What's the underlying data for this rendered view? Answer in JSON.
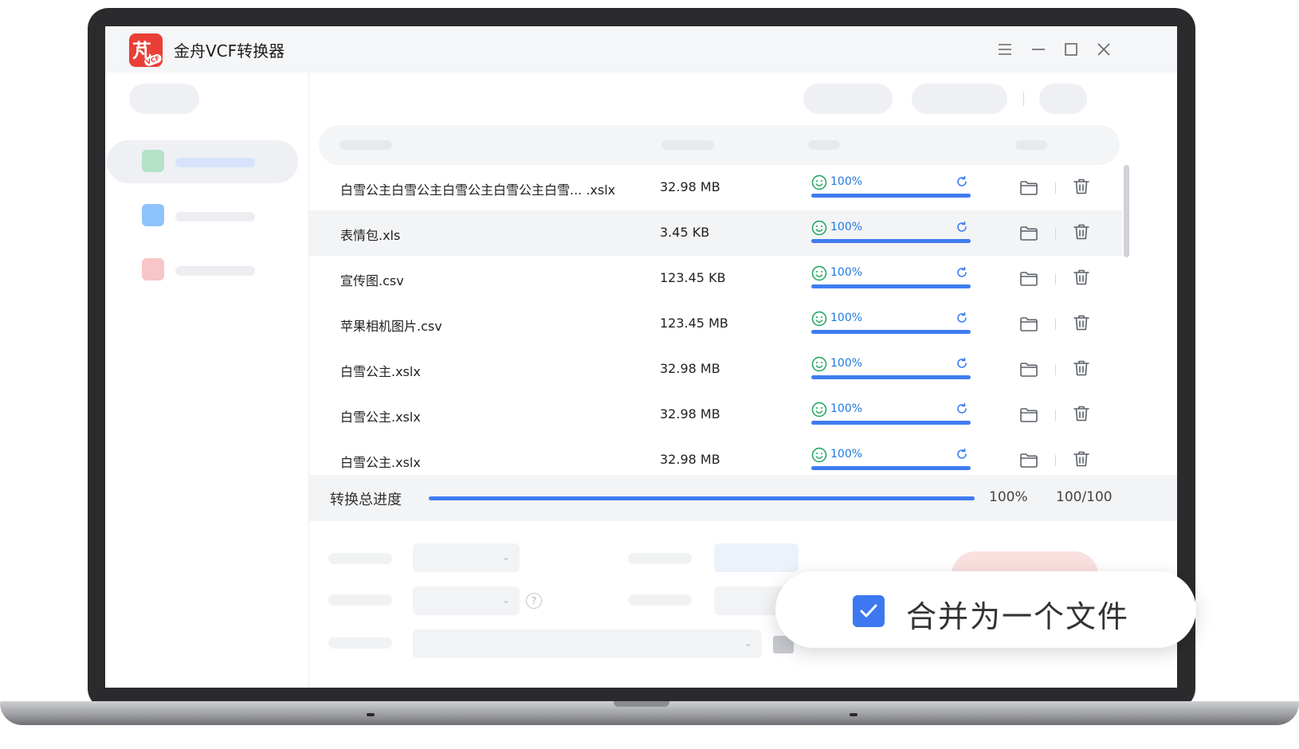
{
  "app": {
    "title": "金舟VCF转换器",
    "logo_glyph": "芃",
    "logo_tag": "VCF"
  },
  "window_controls": [
    "menu-icon",
    "minimize-icon",
    "maximize-icon",
    "close-icon"
  ],
  "files": [
    {
      "name": "白雪公主白雪公主白雪公主白雪公主白雪... .xslx",
      "size": "32.98 MB",
      "progress": "100%"
    },
    {
      "name": "表情包.xls",
      "size": "3.45 KB",
      "progress": "100%"
    },
    {
      "name": "宣传图.csv",
      "size": "123.45 KB",
      "progress": "100%"
    },
    {
      "name": "苹果相机图片.csv",
      "size": "123.45 MB",
      "progress": "100%"
    },
    {
      "name": "白雪公主.xslx",
      "size": "32.98 MB",
      "progress": "100%"
    },
    {
      "name": "白雪公主.xslx",
      "size": "32.98 MB",
      "progress": "100%"
    },
    {
      "name": "白雪公主.xslx",
      "size": "32.98 MB",
      "progress": "100%"
    }
  ],
  "total_progress": {
    "label": "转换总进度",
    "percent": "100%",
    "count": "100/100",
    "fraction": 1.0
  },
  "merge_option": {
    "label": "合并为一个文件",
    "checked": true
  },
  "settings_help": "?",
  "colors": {
    "accent": "#3d78f0",
    "progress_text": "#1f7ae0",
    "brand": "#ea3f36",
    "nav_green": "#b5e2c8",
    "nav_blue": "#8fc3fb",
    "nav_red": "#f8c6c6"
  }
}
